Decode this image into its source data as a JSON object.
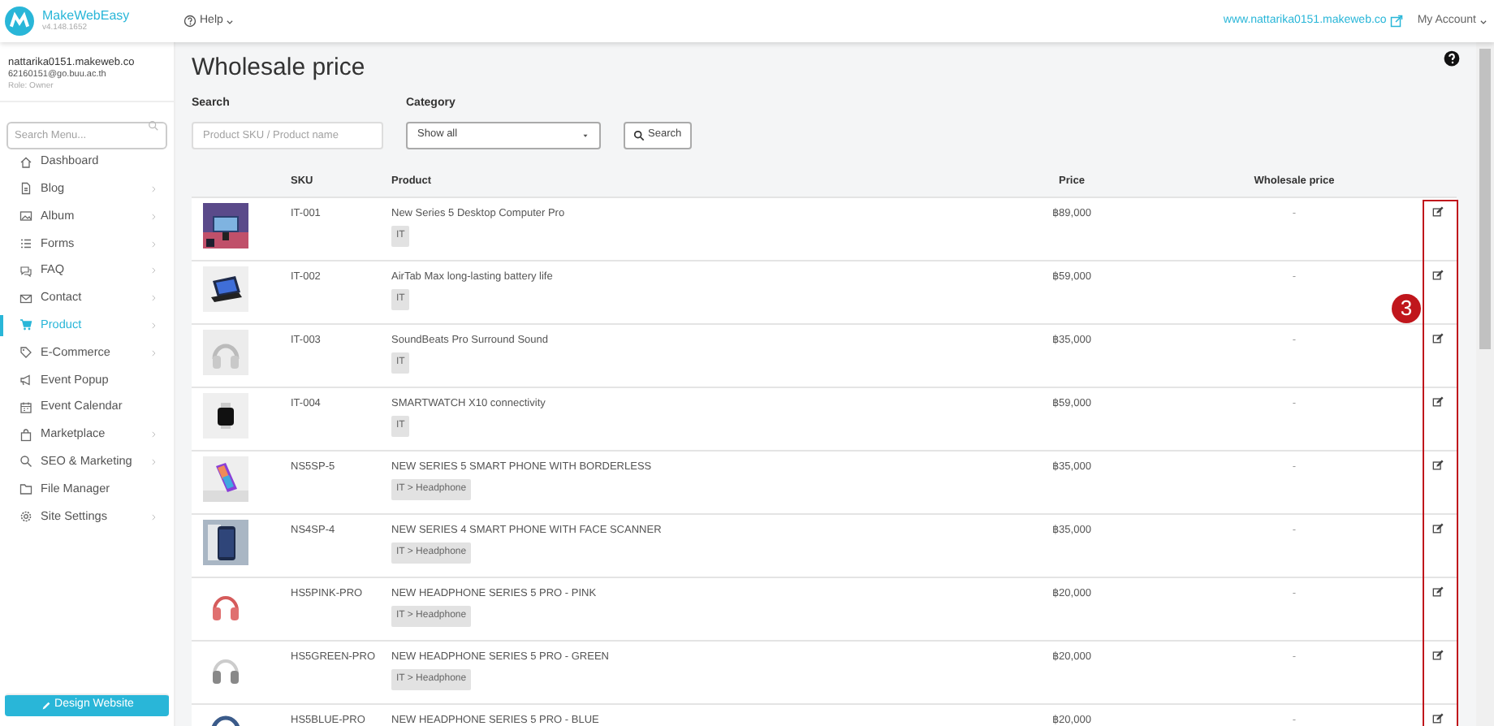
{
  "header": {
    "brand": "MakeWebEasy",
    "version": "v4.148.1652",
    "help": "Help",
    "site_link": "www.nattarika0151.makeweb.co",
    "account": "My Account"
  },
  "sidebar": {
    "user": {
      "site": "nattarika0151.makeweb.co",
      "email": "62160151@go.buu.ac.th",
      "role": "Role: Owner"
    },
    "search": {
      "placeholder": "Search Menu..."
    },
    "items": [
      {
        "label": "Dashboard",
        "has_submenu": false,
        "selected": false
      },
      {
        "label": "Blog",
        "has_submenu": true,
        "selected": false
      },
      {
        "label": "Album",
        "has_submenu": true,
        "selected": false
      },
      {
        "label": "Forms",
        "has_submenu": true,
        "selected": false
      },
      {
        "label": "FAQ",
        "has_submenu": true,
        "selected": false
      },
      {
        "label": "Contact",
        "has_submenu": true,
        "selected": false
      },
      {
        "label": "Product",
        "has_submenu": true,
        "selected": true
      },
      {
        "label": "E-Commerce",
        "has_submenu": true,
        "selected": false
      },
      {
        "label": "Event Popup",
        "has_submenu": false,
        "selected": false
      },
      {
        "label": "Event Calendar",
        "has_submenu": false,
        "selected": false
      },
      {
        "label": "Marketplace",
        "has_submenu": true,
        "selected": false
      },
      {
        "label": "SEO & Marketing",
        "has_submenu": true,
        "selected": false
      },
      {
        "label": "File Manager",
        "has_submenu": false,
        "selected": false
      },
      {
        "label": "Site Settings",
        "has_submenu": true,
        "selected": false
      }
    ],
    "design_button": "Design Website"
  },
  "page": {
    "title": "Wholesale price",
    "filters": {
      "search_label": "Search",
      "search_placeholder": "Product SKU / Product name",
      "category_label": "Category",
      "category_value": "Show all",
      "search_button": "Search"
    },
    "table": {
      "columns": [
        "SKU",
        "Product",
        "Price",
        "Wholesale price"
      ],
      "rows": [
        {
          "sku": "IT-001",
          "product": "New Series 5 Desktop Computer Pro",
          "tag": "IT",
          "price": "฿89,000",
          "wholesale": "-"
        },
        {
          "sku": "IT-002",
          "product": "AirTab Max long-lasting battery life",
          "tag": "IT",
          "price": "฿59,000",
          "wholesale": "-"
        },
        {
          "sku": "IT-003",
          "product": "SoundBeats Pro Surround Sound",
          "tag": "IT",
          "price": "฿35,000",
          "wholesale": "-"
        },
        {
          "sku": "IT-004",
          "product": "SMARTWATCH X10 connectivity",
          "tag": "IT",
          "price": "฿59,000",
          "wholesale": "-"
        },
        {
          "sku": "NS5SP-5",
          "product": "NEW SERIES 5 SMART PHONE WITH BORDERLESS",
          "tag": "IT > Headphone",
          "price": "฿35,000",
          "wholesale": "-"
        },
        {
          "sku": "NS4SP-4",
          "product": "NEW SERIES 4 SMART PHONE WITH FACE SCANNER",
          "tag": "IT > Headphone",
          "price": "฿35,000",
          "wholesale": "-"
        },
        {
          "sku": "HS5PINK-PRO",
          "product": "NEW HEADPHONE SERIES 5 PRO - PINK",
          "tag": "IT > Headphone",
          "price": "฿20,000",
          "wholesale": "-"
        },
        {
          "sku": "HS5GREEN-PRO",
          "product": "NEW HEADPHONE SERIES 5 PRO - GREEN",
          "tag": "IT > Headphone",
          "price": "฿20,000",
          "wholesale": "-"
        },
        {
          "sku": "HS5BLUE-PRO",
          "product": "NEW HEADPHONE SERIES 5 PRO - BLUE",
          "price": "฿20,000",
          "wholesale": "-"
        }
      ]
    }
  },
  "annotation": {
    "label": "3"
  }
}
